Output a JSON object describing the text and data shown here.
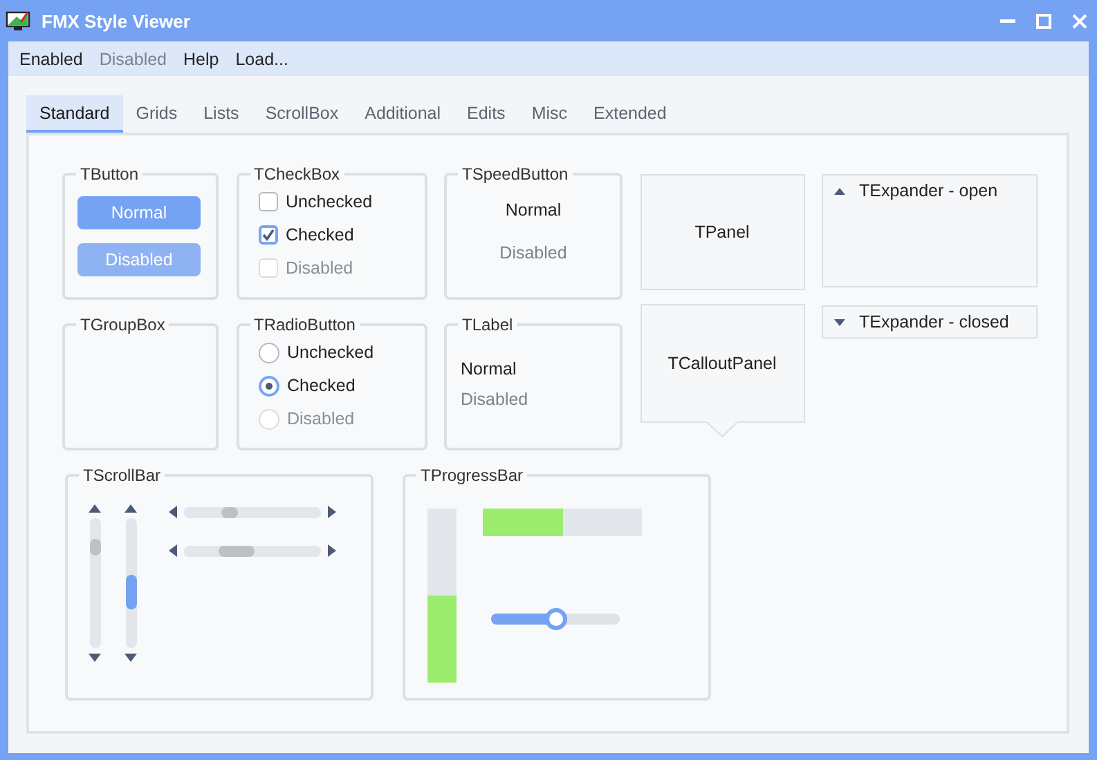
{
  "window": {
    "title": "FMX Style Viewer"
  },
  "menu": [
    {
      "label": "Enabled",
      "disabled": false
    },
    {
      "label": "Disabled",
      "disabled": true
    },
    {
      "label": "Help",
      "disabled": false
    },
    {
      "label": "Load...",
      "disabled": false
    }
  ],
  "tabs": [
    {
      "label": "Standard",
      "selected": true
    },
    {
      "label": "Grids",
      "selected": false
    },
    {
      "label": "Lists",
      "selected": false
    },
    {
      "label": "ScrollBox",
      "selected": false
    },
    {
      "label": "Additional",
      "selected": false
    },
    {
      "label": "Edits",
      "selected": false
    },
    {
      "label": "Misc",
      "selected": false
    },
    {
      "label": "Extended",
      "selected": false
    }
  ],
  "button_group": {
    "title": "TButton",
    "buttons": [
      {
        "label": "Normal",
        "disabled": false
      },
      {
        "label": "Disabled",
        "disabled": true
      }
    ]
  },
  "checkbox_group": {
    "title": "TCheckBox",
    "items": [
      {
        "label": "Unchecked",
        "checked": false,
        "disabled": false
      },
      {
        "label": "Checked",
        "checked": true,
        "disabled": false
      },
      {
        "label": "Disabled",
        "checked": false,
        "disabled": true
      }
    ]
  },
  "speedbutton_group": {
    "title": "TSpeedButton",
    "buttons": [
      {
        "label": "Normal",
        "disabled": false
      },
      {
        "label": "Disabled",
        "disabled": true
      }
    ]
  },
  "panel": {
    "label": "TPanel"
  },
  "callout_panel": {
    "label": "TCalloutPanel"
  },
  "expanders": [
    {
      "label": "TExpander - open",
      "expanded": true
    },
    {
      "label": "TExpander - closed",
      "expanded": false
    }
  ],
  "groupbox": {
    "title": "TGroupBox"
  },
  "radio_group": {
    "title": "TRadioButton",
    "items": [
      {
        "label": "Unchecked",
        "selected": false,
        "disabled": false
      },
      {
        "label": "Checked",
        "selected": true,
        "disabled": false
      },
      {
        "label": "Disabled",
        "selected": false,
        "disabled": true
      }
    ]
  },
  "label_group": {
    "title": "TLabel",
    "labels": [
      {
        "text": "Normal",
        "disabled": false
      },
      {
        "text": "Disabled",
        "disabled": true
      }
    ]
  },
  "scrollbar_group": {
    "title": "TScrollBar",
    "scrollbars": [
      {
        "kind": "vertical",
        "focused": false
      },
      {
        "kind": "vertical",
        "focused": true
      },
      {
        "kind": "horizontal",
        "focused": false
      },
      {
        "kind": "horizontal",
        "focused": false
      }
    ]
  },
  "progressbar_group": {
    "title": "TProgressBar",
    "progress_bars": [
      {
        "kind": "vertical",
        "level": 0.5
      },
      {
        "kind": "horizontal",
        "level": 0.5
      }
    ],
    "slider": {
      "level": 0.5
    }
  }
}
